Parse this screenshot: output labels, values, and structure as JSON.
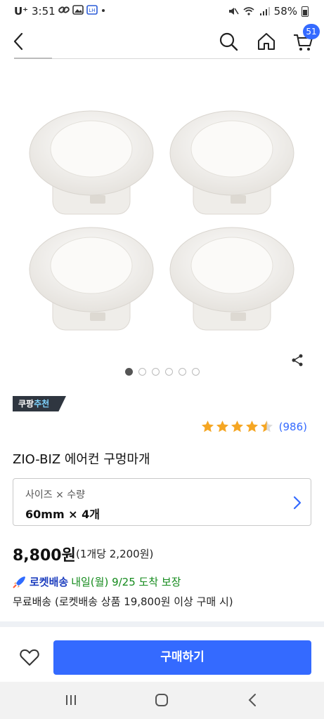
{
  "status_bar": {
    "carrier": "U⁺",
    "time": "3:51",
    "icons": [
      "link-icon",
      "image-icon",
      "lh-app-icon",
      "dot-icon"
    ],
    "right_icons": [
      "mute-icon",
      "wifi-icon",
      "signal-icon"
    ],
    "battery": "58%"
  },
  "header": {
    "back_icon": "back-arrow-icon",
    "search_icon": "search-icon",
    "home_icon": "home-icon",
    "cart_icon": "cart-icon",
    "cart_count": "51"
  },
  "gallery": {
    "image_count": 6,
    "active_index": 0
  },
  "product": {
    "recommend_badge_a": "쿠팡",
    "recommend_badge_b": "추천",
    "rating_stars": 4.5,
    "review_count": "(986)",
    "title": "ZIO-BIZ 에어컨 구멍마개"
  },
  "option": {
    "label": "사이즈 × 수량",
    "value": "60mm × 4개"
  },
  "price": {
    "amount": "8,800원",
    "unit": "(1개당 2,200원)"
  },
  "delivery": {
    "rocket_label": "로켓배송",
    "arrival": "내일(월) 9/25 도착 보장",
    "shipping": "무료배송 (로켓배송 상품 19,800원 이상 구매 시)"
  },
  "bottom": {
    "buy_label": "구매하기"
  },
  "colors": {
    "accent": "#346aff",
    "rocket_green": "#138a1b",
    "star": "#f5a623"
  }
}
